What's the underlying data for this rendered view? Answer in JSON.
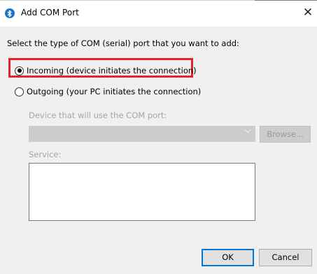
{
  "window": {
    "title": "Add COM Port",
    "close_glyph": "✕",
    "icon": "bluetooth-icon",
    "accent_color": "#1a73c7"
  },
  "prompt": "Select the type of COM (serial) port that you want to add:",
  "options": [
    {
      "label": "Incoming (device initiates the connection)",
      "selected": true
    },
    {
      "label": "Outgoing (your PC initiates the connection)",
      "selected": false
    }
  ],
  "device": {
    "label": "Device that will use the COM port:",
    "browse_label": "Browse..."
  },
  "service": {
    "label": "Service:"
  },
  "buttons": {
    "ok": "OK",
    "cancel": "Cancel"
  },
  "highlight_color": "#e8212b"
}
